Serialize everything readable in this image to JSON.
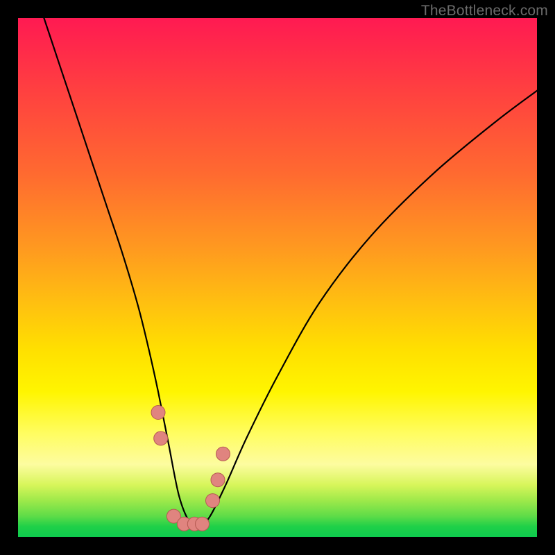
{
  "watermark": "TheBottleneck.com",
  "colors": {
    "frame": "#000000",
    "curve_stroke": "#000000",
    "marker_fill": "#e0847f",
    "marker_stroke": "#b55a52"
  },
  "chart_data": {
    "type": "line",
    "title": "",
    "xlabel": "",
    "ylabel": "",
    "xlim": [
      0,
      100
    ],
    "ylim": [
      0,
      100
    ],
    "grid": false,
    "legend": false,
    "notes": "No numeric axis ticks or labels are visible; values are pixel-estimated on a 0–100 normalized scale. Curve is a V-shaped bottleneck profile with its minimum near x≈31–36, y≈2, and salmon-colored markers clustered around the trough.",
    "series": [
      {
        "name": "curve",
        "x": [
          5,
          8,
          11,
          14,
          17,
          20,
          23,
          25,
          27,
          29,
          31,
          33,
          35,
          37,
          40,
          44,
          50,
          58,
          68,
          80,
          92,
          100
        ],
        "y": [
          100,
          91,
          82,
          73,
          64,
          55,
          45,
          37,
          28,
          18,
          8,
          3,
          2,
          4,
          10,
          19,
          31,
          45,
          58,
          70,
          80,
          86
        ]
      }
    ],
    "markers": {
      "name": "highlighted-points",
      "x": [
        27.0,
        27.5,
        30.0,
        32.0,
        34.0,
        35.5,
        37.5,
        38.5,
        39.5
      ],
      "y": [
        24.0,
        19.0,
        4.0,
        2.5,
        2.5,
        2.5,
        7.0,
        11.0,
        16.0
      ]
    }
  }
}
